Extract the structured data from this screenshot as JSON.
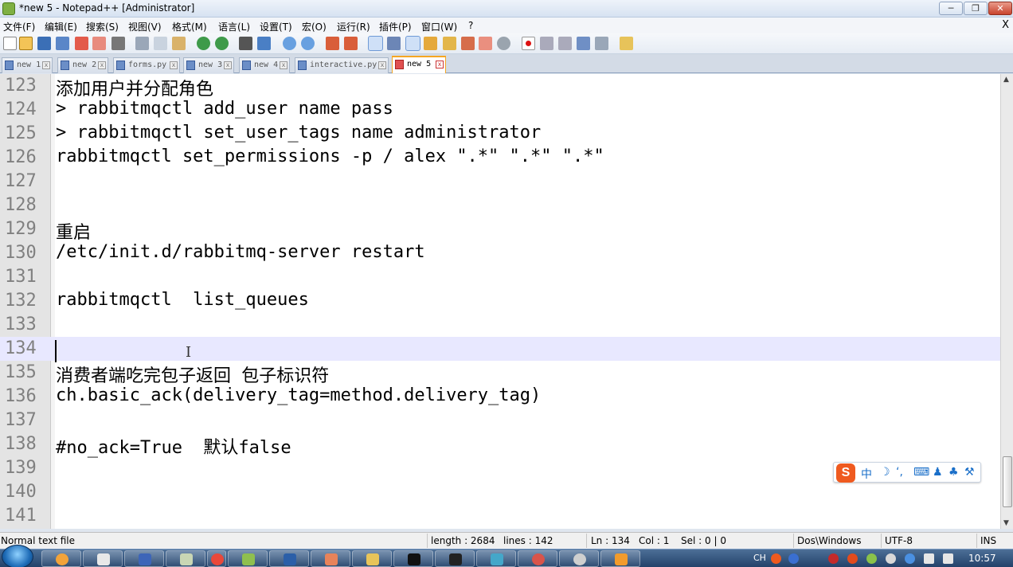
{
  "window": {
    "title": "*new 5 - Notepad++ [Administrator]",
    "controls": {
      "minimize": "─",
      "maximize": "❐",
      "close": "✕"
    }
  },
  "menu": {
    "items": [
      "文件(F)",
      "编辑(E)",
      "搜索(S)",
      "视图(V)",
      "格式(M)",
      "语言(L)",
      "设置(T)",
      "宏(O)",
      "运行(R)",
      "插件(P)",
      "窗口(W)",
      "?"
    ],
    "close_doc": "X"
  },
  "tabs": [
    {
      "label": "new 1",
      "active": false
    },
    {
      "label": "new 2",
      "active": false
    },
    {
      "label": "forms.py",
      "active": false
    },
    {
      "label": "new 3",
      "active": false
    },
    {
      "label": "new 4",
      "active": false
    },
    {
      "label": "interactive.py",
      "active": false
    },
    {
      "label": "new 5",
      "active": true
    }
  ],
  "editor": {
    "current_line": 134,
    "lines": [
      {
        "num": "123",
        "text": "添加用户并分配角色"
      },
      {
        "num": "124",
        "text": "> rabbitmqctl add_user name pass"
      },
      {
        "num": "125",
        "text": "> rabbitmqctl set_user_tags name administrator"
      },
      {
        "num": "126",
        "text": "rabbitmqctl set_permissions -p / alex \".*\" \".*\" \".*\""
      },
      {
        "num": "127",
        "text": ""
      },
      {
        "num": "128",
        "text": ""
      },
      {
        "num": "129",
        "text": "重启"
      },
      {
        "num": "130",
        "text": "/etc/init.d/rabbitmq-server restart"
      },
      {
        "num": "131",
        "text": ""
      },
      {
        "num": "132",
        "text": "rabbitmqctl  list_queues"
      },
      {
        "num": "133",
        "text": ""
      },
      {
        "num": "134",
        "text": ""
      },
      {
        "num": "135",
        "text": "消费者端吃完包子返回 包子标识符"
      },
      {
        "num": "136",
        "text": "ch.basic_ack(delivery_tag=method.delivery_tag)"
      },
      {
        "num": "137",
        "text": ""
      },
      {
        "num": "138",
        "text": "#no_ack=True  默认false"
      },
      {
        "num": "139",
        "text": ""
      },
      {
        "num": "140",
        "text": ""
      },
      {
        "num": "141",
        "text": ""
      }
    ]
  },
  "ime": {
    "logo": "S",
    "items": [
      "中",
      "☽",
      "‘,",
      "⌨",
      "♟",
      "♣",
      "⚒"
    ]
  },
  "status": {
    "file_type": "Normal text file",
    "length": "length : 2684",
    "lines": "lines : 142",
    "ln": "Ln : 134",
    "col": "Col : 1",
    "sel": "Sel : 0 | 0",
    "eol": "Dos\\Windows",
    "encoding": "UTF-8",
    "mode": "INS"
  },
  "taskbar": {
    "tray_lang": "CH",
    "clock": "10:57"
  },
  "colors": {
    "current_line": "#e8e8ff",
    "active_tab_accent": "#f5a623",
    "ime_logo": "#ef5a1f"
  }
}
